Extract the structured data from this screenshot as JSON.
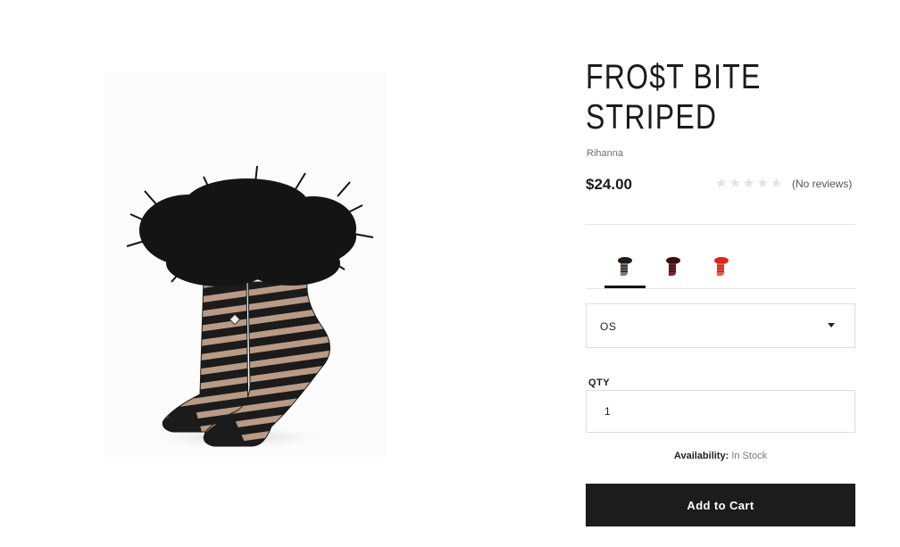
{
  "product": {
    "title_line1": "FRO$T BITE",
    "title_line2": "STRIPED",
    "brand": "Rihanna",
    "price": "$24.00",
    "rating": 0,
    "reviews_text": "(No reviews)",
    "image_icon": "sock-product-image"
  },
  "colors": {
    "accent": "#1c1c1c",
    "star_empty": "#e1e1e1",
    "swatch_black": "#1e1e1e",
    "swatch_burgundy": "#5a1616",
    "swatch_red": "#e0342a"
  },
  "swatches": [
    {
      "name": "black",
      "active": true
    },
    {
      "name": "burgundy",
      "active": false
    },
    {
      "name": "red",
      "active": false
    }
  ],
  "size": {
    "selected": "OS"
  },
  "qty": {
    "label": "QTY",
    "value": "1"
  },
  "availability": {
    "label": "Availability:",
    "status": "In Stock"
  },
  "cart": {
    "button_label": "Add to Cart"
  }
}
